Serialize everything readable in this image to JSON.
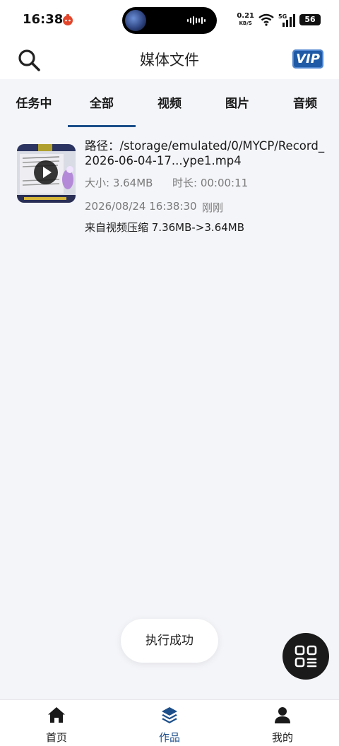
{
  "status_bar": {
    "time": "16:38",
    "net_speed": "0.21",
    "net_unit": "KB/S",
    "signal_label": "5G",
    "battery": "56"
  },
  "header": {
    "title": "媒体文件",
    "vip_label": "VIP"
  },
  "tabs": [
    {
      "label": "任务中"
    },
    {
      "label": "全部"
    },
    {
      "label": "视频"
    },
    {
      "label": "图片"
    },
    {
      "label": "音频"
    }
  ],
  "active_tab": "全部",
  "media_item": {
    "path": "路径：/storage/emulated/0/MYCP/Record_2026-06-04-17...ype1.mp4",
    "size": "大小: 3.64MB",
    "duration": "时长: 00:00:11",
    "date": "2026/08/24 16:38:30",
    "ago": "刚刚",
    "source": "来自视频压缩  7.36MB->3.64MB"
  },
  "toast": {
    "message": "执行成功"
  },
  "fab": {
    "icon": "grid-menu-icon"
  },
  "bottom_nav": [
    {
      "label": "首页",
      "icon": "home-icon"
    },
    {
      "label": "作品",
      "icon": "layers-icon"
    },
    {
      "label": "我的",
      "icon": "person-icon"
    }
  ],
  "active_nav": "作品",
  "colors": {
    "accent": "#1d4f8a",
    "vip": "#1f5aa6",
    "background": "#f4f5f9",
    "fab": "#1a1a1a"
  }
}
